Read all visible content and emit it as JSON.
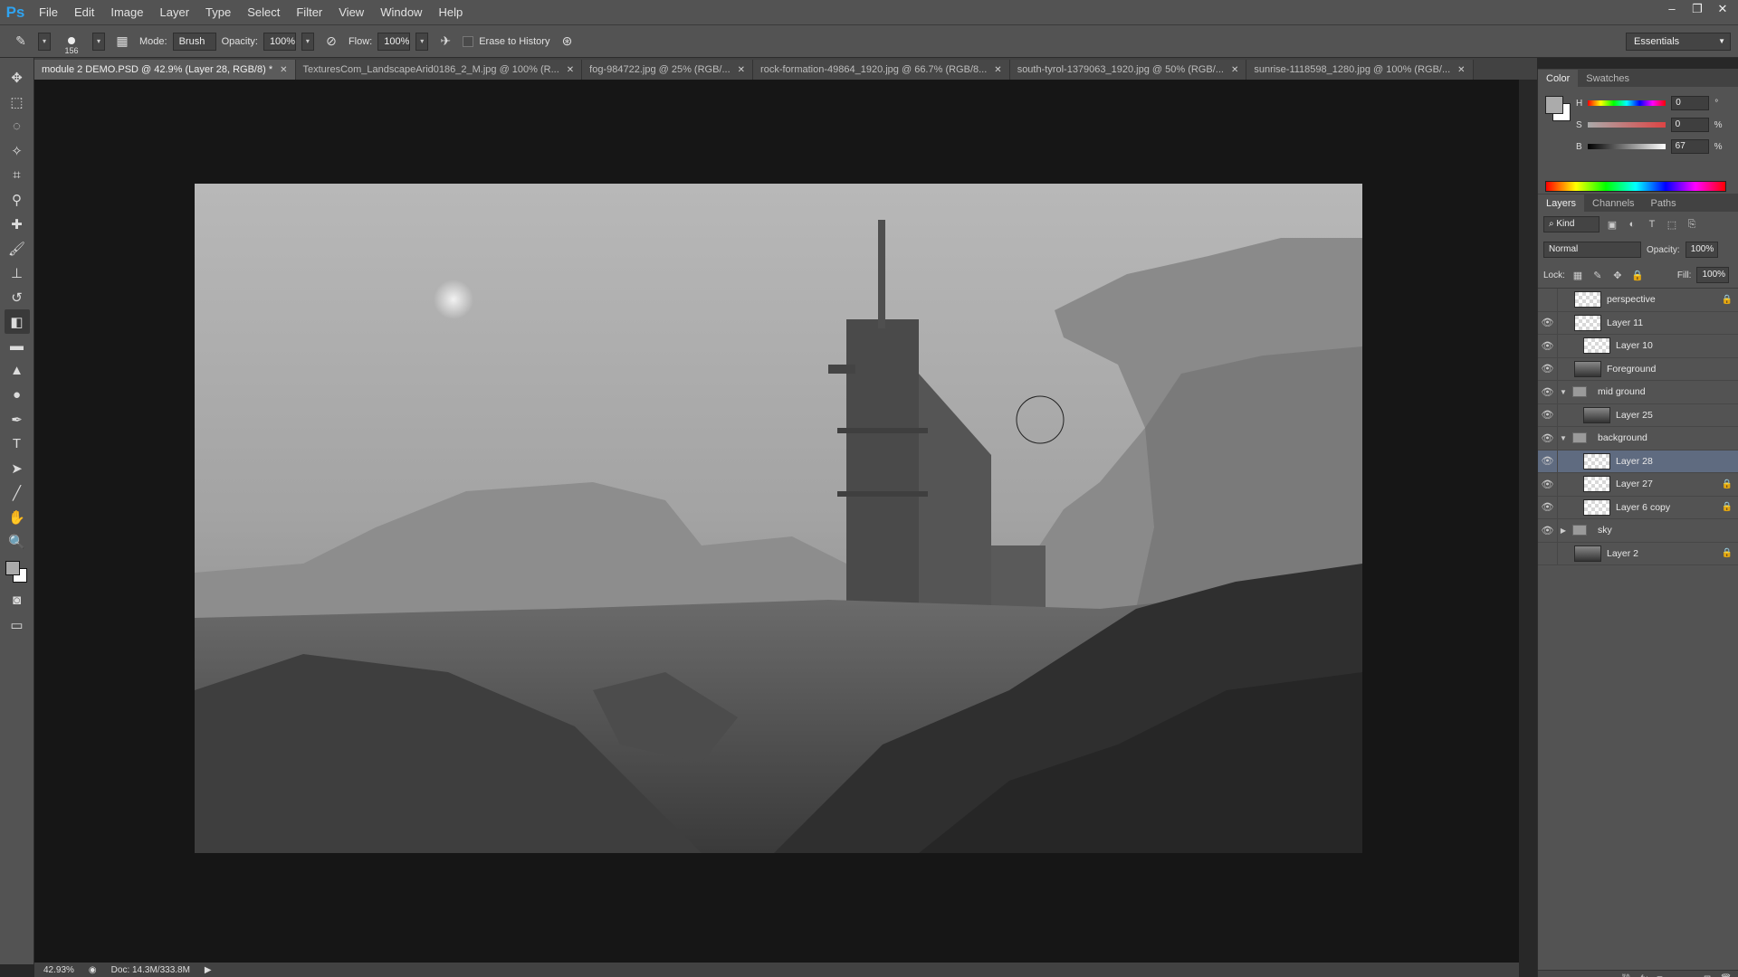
{
  "app": {
    "logo": "Ps"
  },
  "menu": [
    "File",
    "Edit",
    "Image",
    "Layer",
    "Type",
    "Select",
    "Filter",
    "View",
    "Window",
    "Help"
  ],
  "window_controls": {
    "minimize": "–",
    "restore": "❐",
    "close": "✕"
  },
  "options": {
    "brush_size": "156",
    "mode_label": "Mode:",
    "mode_value": "Brush",
    "opacity_label": "Opacity:",
    "opacity_value": "100%",
    "flow_label": "Flow:",
    "flow_value": "100%",
    "erase_history_label": "Erase to History",
    "workspace": "Essentials"
  },
  "tabs": [
    {
      "label": "module 2 DEMO.PSD @ 42.9% (Layer 28, RGB/8) *",
      "active": true
    },
    {
      "label": "TexturesCom_LandscapeArid0186_2_M.jpg @ 100% (R...",
      "active": false
    },
    {
      "label": "fog-984722.jpg @ 25% (RGB/...",
      "active": false
    },
    {
      "label": "rock-formation-49864_1920.jpg @ 66.7% (RGB/8...",
      "active": false
    },
    {
      "label": "south-tyrol-1379063_1920.jpg @ 50% (RGB/...",
      "active": false
    },
    {
      "label": "sunrise-1118598_1280.jpg @ 100% (RGB/...",
      "active": false
    }
  ],
  "status": {
    "zoom": "42.93%",
    "doc": "Doc: 14.3M/333.8M"
  },
  "color_panel": {
    "tabs": [
      "Color",
      "Swatches"
    ],
    "h_label": "H",
    "h_value": "0",
    "h_unit": "°",
    "s_label": "S",
    "s_value": "0",
    "s_unit": "%",
    "b_label": "B",
    "b_value": "67",
    "b_unit": "%",
    "foreground": "#ababab",
    "background": "#ffffff"
  },
  "layers_panel": {
    "tabs": [
      "Layers",
      "Channels",
      "Paths"
    ],
    "kind_label": "Kind",
    "blend_mode": "Normal",
    "opacity_label": "Opacity:",
    "opacity_value": "100%",
    "lock_label": "Lock:",
    "fill_label": "Fill:",
    "fill_value": "100%",
    "layers": [
      {
        "name": "perspective",
        "visible": false,
        "locked": true,
        "kind": "layer",
        "indent": 0
      },
      {
        "name": "Layer 11",
        "visible": true,
        "locked": false,
        "kind": "layer",
        "indent": 0
      },
      {
        "name": "Layer 10",
        "visible": true,
        "locked": false,
        "kind": "layer",
        "indent": 1
      },
      {
        "name": "Foreground",
        "visible": true,
        "locked": false,
        "kind": "layer",
        "indent": 0
      },
      {
        "name": "mid ground",
        "visible": true,
        "locked": false,
        "kind": "group-open",
        "indent": 0
      },
      {
        "name": "Layer 25",
        "visible": true,
        "locked": false,
        "kind": "layer",
        "indent": 1
      },
      {
        "name": "background",
        "visible": true,
        "locked": false,
        "kind": "group-open",
        "indent": 0
      },
      {
        "name": "Layer 28",
        "visible": true,
        "locked": false,
        "kind": "layer",
        "indent": 1,
        "selected": true
      },
      {
        "name": "Layer 27",
        "visible": true,
        "locked": true,
        "kind": "layer",
        "indent": 1
      },
      {
        "name": "Layer 6 copy",
        "visible": true,
        "locked": true,
        "kind": "layer",
        "indent": 1
      },
      {
        "name": "sky",
        "visible": true,
        "locked": false,
        "kind": "group-closed",
        "indent": 0
      },
      {
        "name": "Layer 2",
        "visible": false,
        "locked": true,
        "kind": "layer",
        "indent": 0
      }
    ]
  }
}
